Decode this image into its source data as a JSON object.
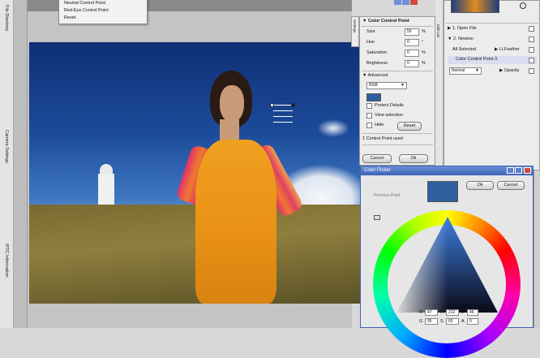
{
  "left_tabs": [
    "File Directory",
    "Camera Settings",
    "IPTC Information"
  ],
  "context_menu": [
    "Neutral Control Point",
    "Red-Eye Control Point",
    "Reset"
  ],
  "side_tab_label": "Settings",
  "control_point": {
    "title": "Color Control Point",
    "sliders": [
      {
        "label": "Size",
        "value": "50",
        "unit": "%"
      },
      {
        "label": "Hue",
        "value": "0",
        "unit": "°"
      },
      {
        "label": "Saturation",
        "value": "0",
        "unit": "%"
      },
      {
        "label": "Brightness",
        "value": "0",
        "unit": "%"
      }
    ],
    "advanced_label": "Advanced",
    "mode": "RGB",
    "protect_details": "Protect Details",
    "view_selection": "View selection",
    "hide": "Hide",
    "reset": "Reset",
    "status": "1 Control Point used",
    "cancel": "Cancel",
    "ok": "Ok"
  },
  "edit_list": {
    "tab_label": "Edit List",
    "items": [
      {
        "label": "1. Open File"
      },
      {
        "label": "2. Newton"
      },
      {
        "label": "All Selected"
      },
      {
        "label": "LLFeather"
      },
      {
        "label": "Color Control Point 3"
      }
    ],
    "blend_mode": "Normal",
    "opacity_label": "Opacity"
  },
  "color_picker": {
    "title": "Color Picker",
    "previous_label": "Previous Point",
    "ok": "Ok",
    "cancel": "Cancel",
    "swatch": "#2f5f9f",
    "values": [
      {
        "label": "R",
        "value": "47"
      },
      {
        "label": "H",
        "value": "212"
      },
      {
        "label": "L",
        "value": "46"
      },
      {
        "label": "G",
        "value": "95"
      },
      {
        "label": "S",
        "value": "65"
      },
      {
        "label": "A",
        "value": "0"
      }
    ]
  },
  "colors": {
    "accent": "#3d63b5",
    "sky": "#1c4b9a",
    "dress": "#f0a020"
  }
}
